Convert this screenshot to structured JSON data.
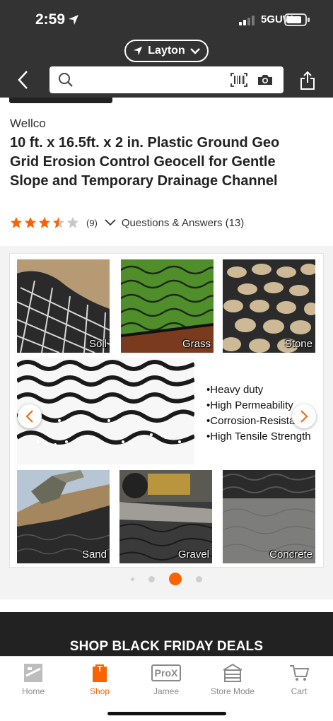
{
  "status_bar": {
    "time": "2:59",
    "network": "5GUW"
  },
  "header": {
    "store_name": "Layton",
    "search_placeholder": ""
  },
  "product": {
    "brand": "Wellco",
    "title": "10 ft. x 16.5ft. x 2 in. Plastic Ground Geo Grid Erosion Control Geocell for Gentle Slope and Temporary Drainage Channel",
    "rating": 3.5,
    "review_count": "(9)",
    "qa_label": "Questions & Answers (13)"
  },
  "gallery": {
    "tiles": [
      {
        "label": "Soil"
      },
      {
        "label": "Grass"
      },
      {
        "label": "Stone"
      },
      {
        "label": "Sand"
      },
      {
        "label": "Gravel"
      },
      {
        "label": "Concrete"
      }
    ],
    "features": [
      "Heavy duty",
      "High Permeability",
      "Corrosion-Resista",
      "High Tensile Strength"
    ],
    "bullet": "•",
    "page_count": 4,
    "active_page": 3
  },
  "promo": {
    "text": "SHOP BLACK FRIDAY DEALS"
  },
  "tabbar": {
    "items": [
      {
        "label": "Home",
        "icon": "home-depot-logo-icon",
        "active": false
      },
      {
        "label": "Shop",
        "icon": "shop-icon",
        "active": true
      },
      {
        "label": "Jamee",
        "icon": "prox-icon",
        "badge": "ProX",
        "active": false
      },
      {
        "label": "Store Mode",
        "icon": "store-icon",
        "active": false
      },
      {
        "label": "Cart",
        "icon": "cart-icon",
        "active": false
      }
    ]
  },
  "colors": {
    "accent": "#f96302",
    "header_bg": "#333333",
    "star": "#f96302"
  }
}
